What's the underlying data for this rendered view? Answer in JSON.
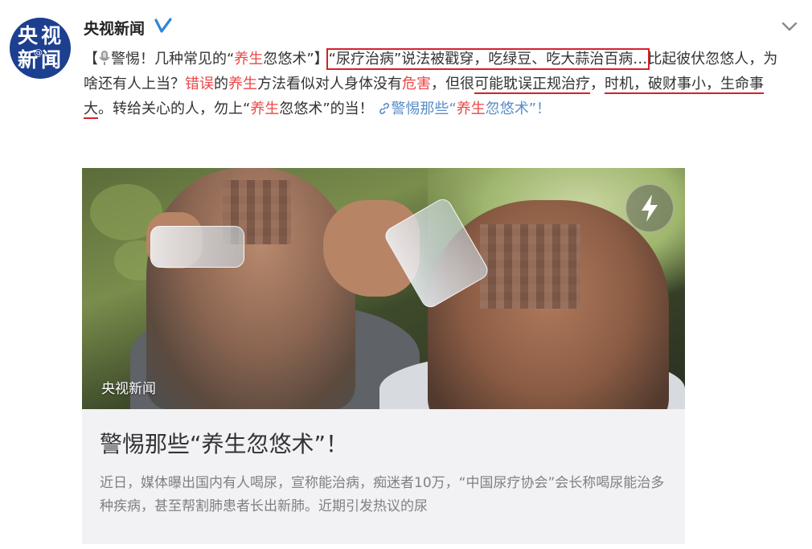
{
  "account": {
    "name": "央视新闻",
    "avatar_chars": [
      "央",
      "视",
      "新",
      "闻"
    ],
    "avatar_at": "@",
    "verified_icon": "verified-v-icon",
    "menu_icon": "chevron-down-icon"
  },
  "post": {
    "t_open": "【",
    "t_headline_a": "警惕！几种常见的“",
    "t_headline_red": "养生",
    "t_headline_b": "忽悠术”",
    "t_close": "】",
    "t_box": "“尿疗治病”说法被戳穿，吃绿豆、吃大蒜治百病…",
    "t_1": "比起彼伏忽悠人，为啥还有人上当？",
    "t_red_1": "错误",
    "t_2": "的",
    "t_red_2": "养生",
    "t_3": "方法看似对人身体没有",
    "t_red_3": "危害",
    "t_4": "，但很",
    "t_ul_1": "可能耽误正规治疗",
    "t_5": "，",
    "t_ul_2": "时机，破财事小，生命事大",
    "t_6": "。转给关心的人，勿上“",
    "t_red_4": "养生",
    "t_7": "忽悠术”的当！",
    "link_a": "警惕那些“",
    "link_red": "养生",
    "link_b": "忽悠术”！",
    "colors": {
      "highlight": "#eb4747",
      "link": "#5b8dc8",
      "annotation": "#d6202a"
    }
  },
  "media": {
    "caption": "央视新闻",
    "play_icon": "lightning-bolt-icon"
  },
  "card": {
    "title": "警惕那些“养生忽悠术”！",
    "description": "近日，媒体曝出国内有人喝尿，宣称能治病，痴迷者10万，“中国尿疗协会”会长称喝尿能治多种疾病，甚至帮割肺患者长出新肺。近期引发热议的尿"
  }
}
